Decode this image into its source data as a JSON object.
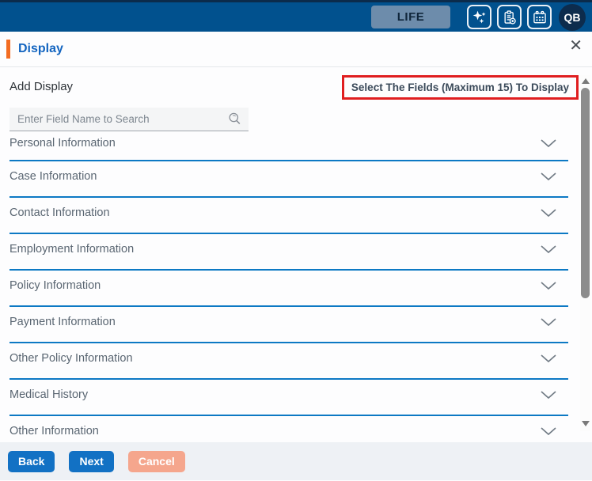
{
  "topbar": {
    "life_button_label": "LIFE",
    "avatar_initials": "QB",
    "icon_names": [
      "sparkles-icon",
      "clipboard-add-icon",
      "calendar-icon"
    ]
  },
  "panel": {
    "title": "Display",
    "close_glyph": "✕"
  },
  "main": {
    "add_display_label": "Add Display",
    "fields_notice": "Select The Fields (Maximum 15) To Display",
    "search_placeholder": "Enter Field Name to Search"
  },
  "sections": [
    {
      "label": "Personal Information"
    },
    {
      "label": "Case Information"
    },
    {
      "label": "Contact Information"
    },
    {
      "label": "Employment Information"
    },
    {
      "label": "Policy Information"
    },
    {
      "label": "Payment Information"
    },
    {
      "label": "Other Policy Information"
    },
    {
      "label": "Medical History"
    },
    {
      "label": "Other Information"
    }
  ],
  "footer": {
    "back_label": "Back",
    "next_label": "Next",
    "cancel_label": "Cancel"
  },
  "colors": {
    "header_bg": "#01518E",
    "accent_orange": "#F36C21",
    "title_blue": "#1465C0",
    "section_underline_blue": "#0D79C4",
    "notice_border_red": "#E01E20",
    "primary_button_blue": "#1271C4",
    "cancel_button_salmon": "#F5A68D"
  }
}
